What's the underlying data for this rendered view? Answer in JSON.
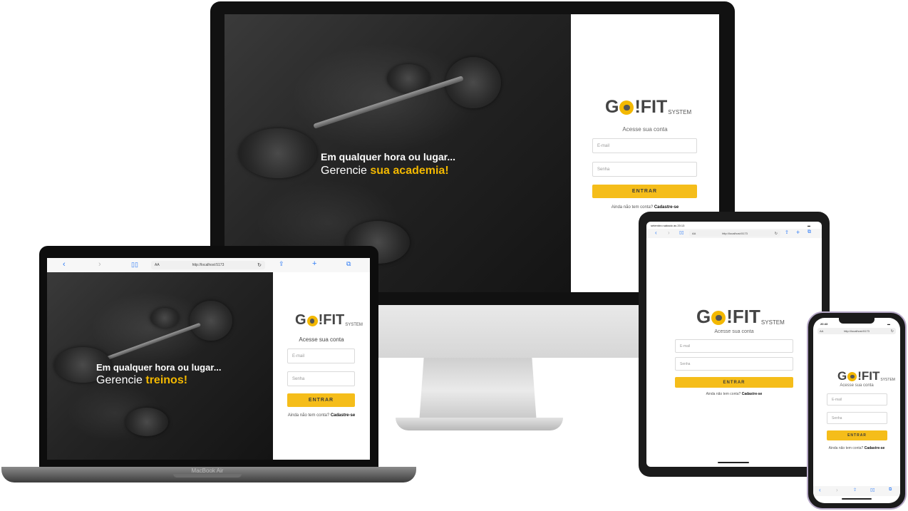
{
  "imac": {
    "tagline_line1": "Em qualquer hora ou lugar...",
    "tagline_prefix": "Gerencie",
    "tagline_highlight": "sua academia!",
    "logo_main": "G",
    "logo_rest": "!FIT",
    "logo_system": "SYSTEM",
    "subtitle": "Acesse sua conta",
    "email_placeholder": "E-mail",
    "password_placeholder": "Senha",
    "button": "ENTRAR",
    "signup_prefix": "Ainda não tem conta?",
    "signup_link": "Cadastre-se"
  },
  "macbook": {
    "address": "http://localhost:5173",
    "address_aa": "AA",
    "device_label": "MacBook Air",
    "tagline_line1": "Em qualquer hora ou lugar...",
    "tagline_prefix": "Gerencie",
    "tagline_highlight": "treinos!",
    "logo_main": "G",
    "logo_rest": "!FIT",
    "logo_system": "SYSTEM",
    "subtitle": "Acesse sua conta",
    "email_placeholder": "E-mail",
    "password_placeholder": "Senha",
    "button": "ENTRAR",
    "signup_prefix": "Ainda não tem conta?",
    "signup_link": "Cadastre-se",
    "toolbar_icons": [
      "chevron-left-icon",
      "chevron-right-icon",
      "book-icon",
      "refresh-icon",
      "share-icon",
      "plus-icon",
      "tabs-icon"
    ]
  },
  "ipad": {
    "status_left": "setembro sábado às 20:13",
    "address": "http://localhost:5173",
    "address_aa": "AA",
    "logo_main": "G",
    "logo_rest": "!FIT",
    "logo_system": "SYSTEM",
    "subtitle": "Acesse sua conta",
    "email_placeholder": "E-mail",
    "password_placeholder": "Senha",
    "button": "ENTRAR",
    "signup_prefix": "Ainda não tem conta?",
    "signup_link": "Cadastre-se"
  },
  "iphone": {
    "status_time": "20:43",
    "address": "http://localhost:5173",
    "address_aa": "AA",
    "logo_main": "G",
    "logo_rest": "!FIT",
    "logo_system": "SYSTEM",
    "subtitle": "Acesse sua conta",
    "email_placeholder": "E-mail",
    "password_placeholder": "Senha",
    "button": "ENTRAR",
    "signup_prefix": "Ainda não tem conta?",
    "signup_link": "Cadastre-se"
  },
  "colors": {
    "accent": "#f5bd1a",
    "highlight_text": "#f3b800",
    "frame": "#111111"
  }
}
